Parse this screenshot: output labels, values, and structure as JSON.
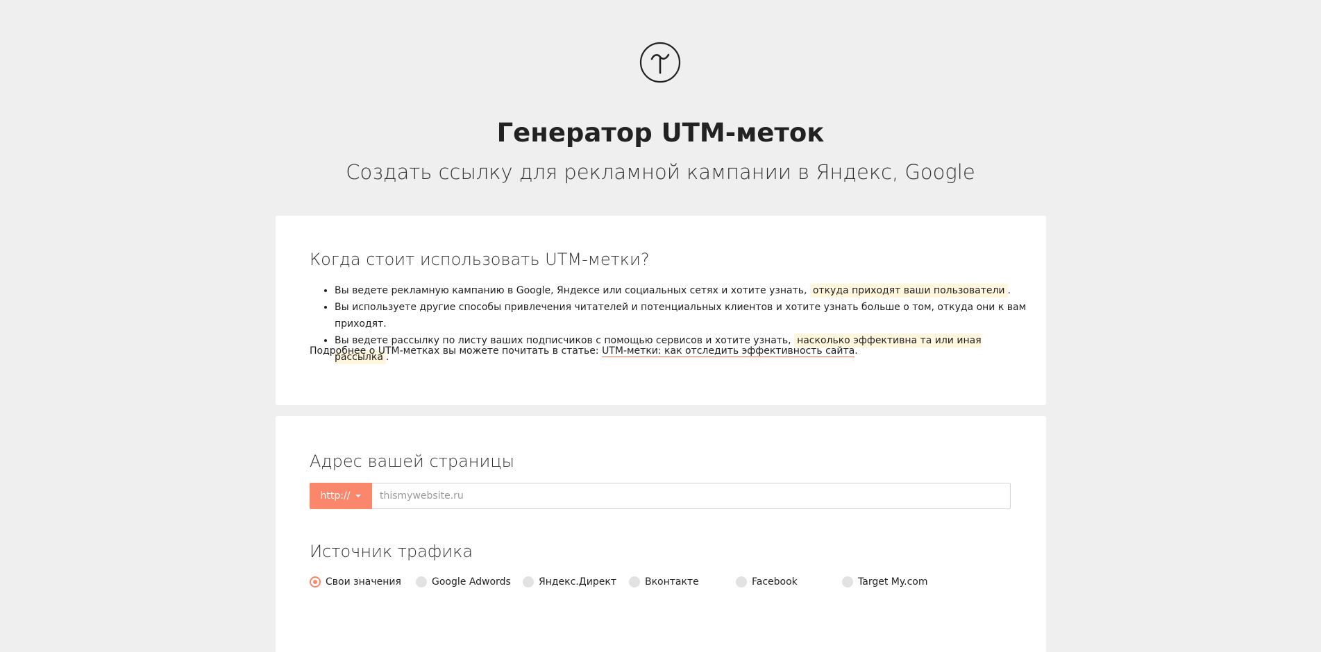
{
  "header": {
    "logo_glyph": "Т",
    "title": "Генератор UTM-меток",
    "subtitle": "Создать ссылку для рекламной кампании в Яндекс, Google"
  },
  "info": {
    "heading": "Когда стоит использовать UTM-метки?",
    "bullets": [
      {
        "text": "Вы ведете рекламную кампанию в Google, Яндексе или социальных сетях и хотите узнать, ",
        "highlight": "откуда приходят ваши пользователи",
        "end": "."
      },
      {
        "text": "Вы используете другие способы привлечения читателей и потенциальных клиентов и хотите узнать больше о том, откуда они к вам приходят."
      },
      {
        "text": "Вы ведете рассылку по листу ваших подписчиков с помощью сервисов и хотите узнать, ",
        "highlight": "насколько эффективна та или иная рассылка",
        "end": "."
      }
    ],
    "more_text": "Подробнее о UTM-метках вы можете почитать в статье: ",
    "more_link": "UTM-метки: как отследить эффективность сайта",
    "more_end": "."
  },
  "form": {
    "address_heading": "Адрес вашей страницы",
    "protocol_label": "http://",
    "url_placeholder": "thismywebsite.ru",
    "url_value": "",
    "source_heading": "Источник трафика",
    "source_options": [
      {
        "label": "Свои значения",
        "checked": true
      },
      {
        "label": "Google Adwords",
        "checked": false
      },
      {
        "label": "Яндекс.Директ",
        "checked": false
      },
      {
        "label": "Вконтакте",
        "checked": false
      },
      {
        "label": "Facebook",
        "checked": false
      },
      {
        "label": "Target My.com",
        "checked": false
      }
    ]
  },
  "colors": {
    "accent": "#fa876b",
    "background": "#efefef",
    "card": "#ffffff",
    "highlight": "#fff6dd"
  }
}
